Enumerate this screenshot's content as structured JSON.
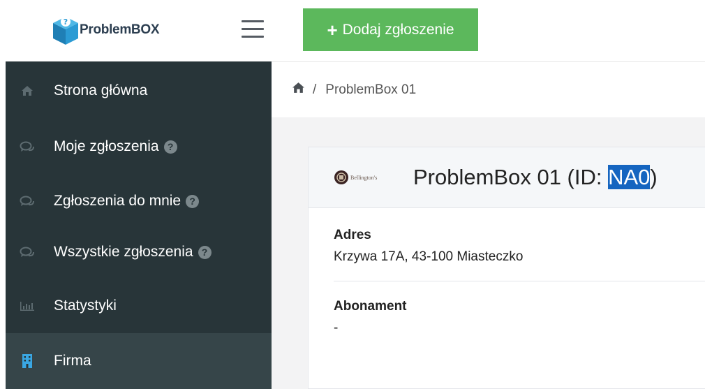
{
  "app": {
    "logo_text_a": "Problem",
    "logo_text_b": "BOX"
  },
  "toolbar": {
    "add_label": "Dodaj zgłoszenie"
  },
  "sidebar": {
    "items": [
      {
        "label": "Strona główna",
        "icon": "home-icon",
        "help": false,
        "active": false
      },
      {
        "label": "Moje zgłoszenia",
        "icon": "comments-icon",
        "help": true,
        "active": false
      },
      {
        "label": "Zgłoszenia do mnie",
        "icon": "comments-icon",
        "help": true,
        "active": false
      },
      {
        "label": "Wszystkie zgłoszenia",
        "icon": "comments-icon",
        "help": true,
        "active": false
      },
      {
        "label": "Statystyki",
        "icon": "bar-chart-icon",
        "help": false,
        "active": false
      },
      {
        "label": "Firma",
        "icon": "building-icon",
        "help": false,
        "active": true
      }
    ],
    "help_glyph": "?"
  },
  "breadcrumb": {
    "separator": "/",
    "current": "ProblemBox 01"
  },
  "card": {
    "logo_text": "Bellington's",
    "title_prefix": "ProblemBox 01 (ID: ",
    "title_id_selected": "NA0",
    "title_suffix": ")",
    "fields": [
      {
        "label": "Adres",
        "value": "Krzywa 17A, 43-100 Miasteczko"
      },
      {
        "label": "Abonament",
        "value": "-"
      }
    ]
  },
  "colors": {
    "sidebar_bg": "#283539",
    "sidebar_active": "#364549",
    "add_button": "#5cb85c",
    "selection": "#1565c0",
    "icon_active": "#3aa7e3"
  }
}
